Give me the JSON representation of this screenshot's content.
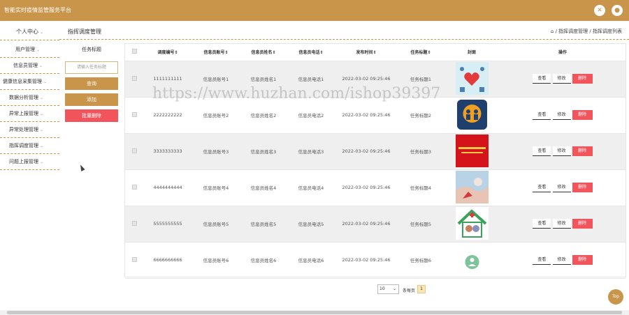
{
  "app": {
    "title": "智能实时疫情监管服务平台"
  },
  "topbar": {
    "icon_close": "close-icon",
    "icon_user": "user-icon",
    "accent": "#c8954a"
  },
  "sidebar": {
    "profile": "个人中心",
    "items": [
      {
        "label": "用户管理"
      },
      {
        "label": "信息员管理"
      },
      {
        "label": "健康信息采集管理"
      },
      {
        "label": "数据分析管理"
      },
      {
        "label": "异常上报管理"
      },
      {
        "label": "异常处理管理"
      },
      {
        "label": "指挥调度管理"
      },
      {
        "label": "问题上报管理"
      }
    ]
  },
  "page": {
    "title": "指挥调度管理",
    "breadcrumb": "/ 指挥调度管理 / 指挥调度列表"
  },
  "filter": {
    "label": "任务标题",
    "placeholder": "请输入任务标题",
    "query_button": "查询",
    "add_button": "添加",
    "batch_delete_button": "批量删除"
  },
  "table": {
    "headers": [
      "调度编号",
      "信息员账号",
      "信息员姓名",
      "信息员电话",
      "发布时间",
      "任务标题",
      "封面",
      "操作"
    ],
    "rows": [
      {
        "id": "1111111111",
        "account": "信息员账号1",
        "name": "信息员姓名1",
        "phone": "信息员电话1",
        "time": "2022-03-02 09:25:46",
        "title": "任务标题1"
      },
      {
        "id": "2222222222",
        "account": "信息员账号2",
        "name": "信息员姓名2",
        "phone": "信息员电话2",
        "time": "2022-03-02 09:25:46",
        "title": "任务标题2"
      },
      {
        "id": "3333333333",
        "account": "信息员账号3",
        "name": "信息员姓名3",
        "phone": "信息员电话3",
        "time": "2022-03-02 09:25:46",
        "title": "任务标题3"
      },
      {
        "id": "4444444444",
        "account": "信息员账号4",
        "name": "信息员姓名4",
        "phone": "信息员电话4",
        "time": "2022-03-02 09:25:46",
        "title": "任务标题4"
      },
      {
        "id": "5555555555",
        "account": "信息员账号5",
        "name": "信息员姓名5",
        "phone": "信息员电话5",
        "time": "2022-03-02 09:25:46",
        "title": "任务标题5"
      },
      {
        "id": "6666666666",
        "account": "信息员账号6",
        "name": "信息员姓名6",
        "phone": "信息员电话6",
        "time": "2022-03-02 09:25:46",
        "title": "任务标题6"
      }
    ],
    "actions": {
      "view": "查看",
      "edit": "修改",
      "delete": "删除"
    }
  },
  "pagination": {
    "page_size": "10",
    "per_page_label": "条每页",
    "current_page": "1"
  },
  "back_to_top": "Top",
  "watermark": "https://www.huzhan.com/ishop39397"
}
